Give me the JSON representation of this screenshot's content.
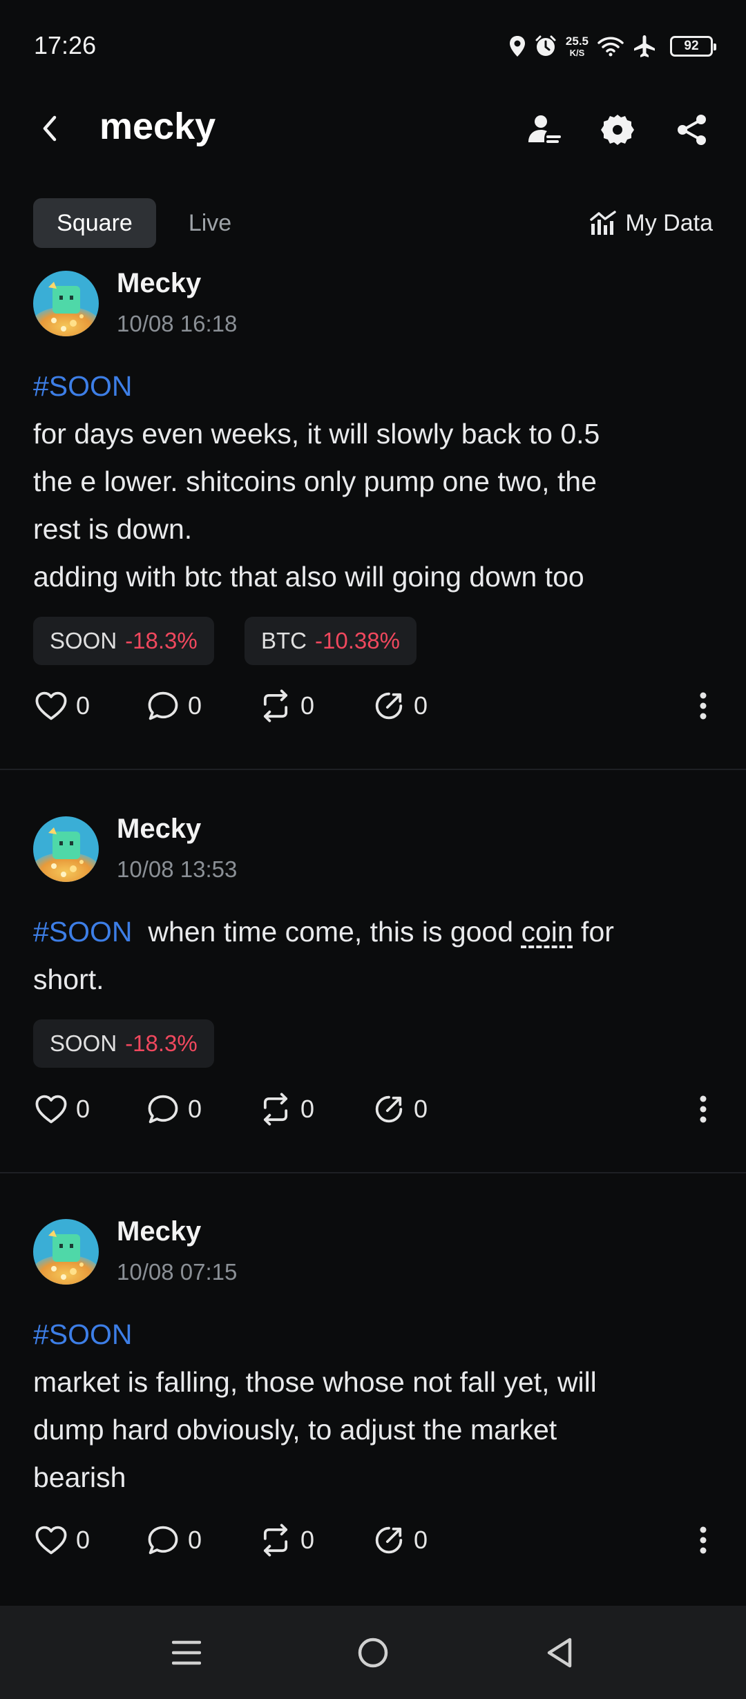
{
  "status_bar": {
    "time": "17:26",
    "net_speed_value": "25.5",
    "net_speed_unit": "K/S",
    "battery": "92"
  },
  "header": {
    "title": "mecky"
  },
  "tabs": {
    "square": "Square",
    "live": "Live",
    "my_data": "My Data"
  },
  "colors": {
    "hashtag": "#3d7ee6",
    "negative": "#f0485e",
    "background": "#0b0c0d",
    "chip_bg": "#1c1e21"
  },
  "posts": [
    {
      "author": "Mecky",
      "time": "10/08 16:18",
      "hashtag": "#SOON",
      "lines": [
        "for days even weeks, it will slowly back to 0.5",
        "the e lower. shitcoins only pump one two, the",
        "rest is down.",
        "adding with btc that also will going down too"
      ],
      "chips": [
        {
          "symbol": "SOON",
          "change": "-18.3%"
        },
        {
          "symbol": "BTC",
          "change": "-10.38%"
        }
      ],
      "likes": "0",
      "comments": "0",
      "reposts": "0",
      "shares": "0"
    },
    {
      "author": "Mecky",
      "time": "10/08 13:53",
      "hashtag": "#SOON",
      "text_before": "when time come, this is good ",
      "text_link": "coin",
      "text_after": " for",
      "text_line2": "short.",
      "chips": [
        {
          "symbol": "SOON",
          "change": "-18.3%"
        }
      ],
      "likes": "0",
      "comments": "0",
      "reposts": "0",
      "shares": "0"
    },
    {
      "author": "Mecky",
      "time": "10/08 07:15",
      "hashtag": "#SOON",
      "lines": [
        "market is falling, those whose not fall yet, will",
        "dump hard obviously, to adjust the market",
        "bearish"
      ],
      "likes": "0",
      "comments": "0",
      "reposts": "0",
      "shares": "0"
    }
  ]
}
